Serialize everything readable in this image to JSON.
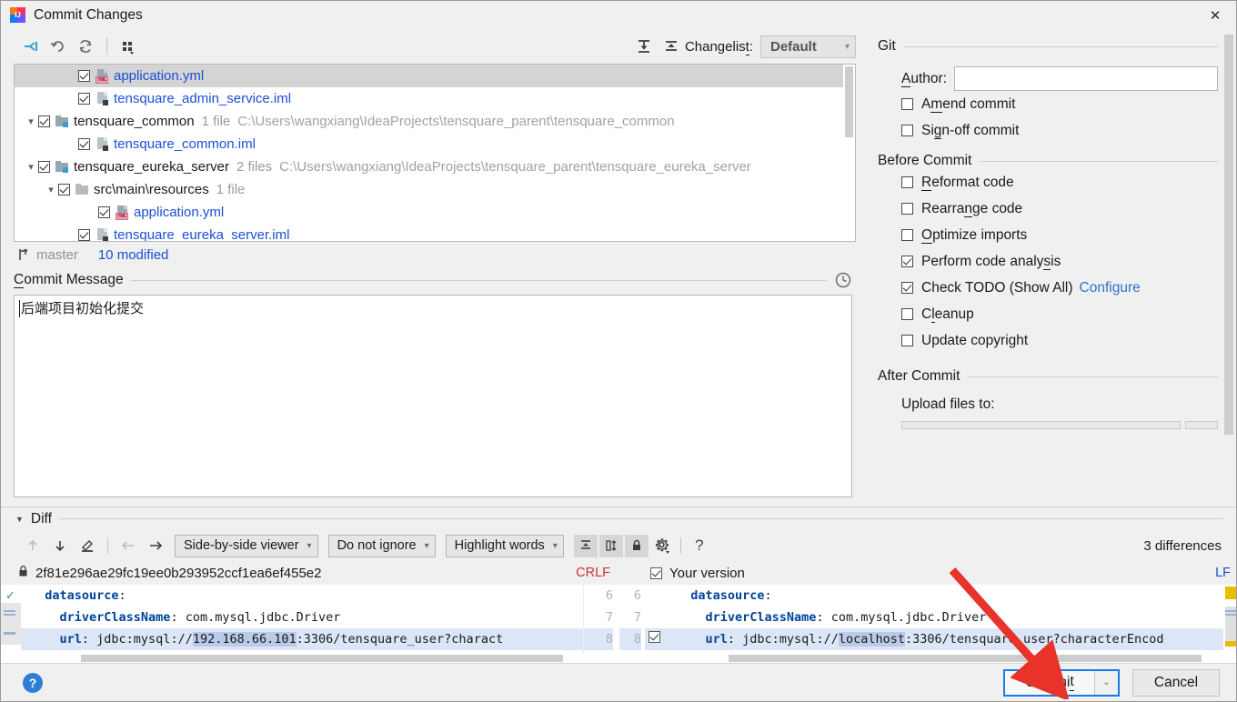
{
  "window": {
    "title": "Commit Changes",
    "app_icon": "intellij-idea-icon",
    "close_label": "✕"
  },
  "changes_toolbar": {
    "buttons": [
      {
        "name": "show-diff-icon",
        "glyph": "→|"
      },
      {
        "name": "revert-icon",
        "glyph": "↶"
      },
      {
        "name": "refresh-icon",
        "glyph": "↻"
      },
      {
        "name": "group-by-icon",
        "glyph": "∷"
      }
    ],
    "expand_all_label": "expand-all-icon",
    "collapse_all_label": "collapse-all-icon",
    "changelist_label": "Changelist:",
    "changelist_value": "Default",
    "changelist_arrow": "⌄"
  },
  "file_tree": {
    "rows": [
      {
        "indent": 2,
        "twisty": "",
        "checked": true,
        "icon": "yml-file-icon",
        "name": "application.yml",
        "link": true,
        "meta": "",
        "path": "",
        "selected": true
      },
      {
        "indent": 2,
        "twisty": "",
        "checked": true,
        "icon": "iml-file-icon",
        "name": "tensquare_admin_service.iml",
        "link": true,
        "meta": "",
        "path": "",
        "selected": false
      },
      {
        "indent": 0,
        "twisty": "⌄",
        "checked": true,
        "icon": "module-folder-icon",
        "name": "tensquare_common",
        "link": false,
        "meta": "1 file",
        "path": "C:\\Users\\wangxiang\\IdeaProjects\\tensquare_parent\\tensquare_common",
        "selected": false
      },
      {
        "indent": 2,
        "twisty": "",
        "checked": true,
        "icon": "iml-file-icon",
        "name": "tensquare_common.iml",
        "link": true,
        "meta": "",
        "path": "",
        "selected": false
      },
      {
        "indent": 0,
        "twisty": "⌄",
        "checked": true,
        "icon": "module-folder-icon",
        "name": "tensquare_eureka_server",
        "link": false,
        "meta": "2 files",
        "path": "C:\\Users\\wangxiang\\IdeaProjects\\tensquare_parent\\tensquare_eureka_server",
        "selected": false
      },
      {
        "indent": 1,
        "twisty": "⌄",
        "checked": true,
        "icon": "folder-icon",
        "name": "src\\main\\resources",
        "link": false,
        "meta": "1 file",
        "path": "",
        "selected": false
      },
      {
        "indent": 3,
        "twisty": "",
        "checked": true,
        "icon": "yml-file-icon",
        "name": "application.yml",
        "link": true,
        "meta": "",
        "path": "",
        "selected": false
      },
      {
        "indent": 2,
        "twisty": "",
        "checked": true,
        "icon": "iml-file-icon",
        "name": "tensquare_eureka_server.iml",
        "link": true,
        "meta": "",
        "path": "",
        "selected": false
      }
    ]
  },
  "branch_bar": {
    "branch_icon": "git-branch-icon",
    "branch": "master",
    "modified": "10 modified"
  },
  "commit_message": {
    "title": "Commit Message",
    "title_mnemonic": "C",
    "history_icon": "clock-history-icon",
    "value": "后端项目初始化提交"
  },
  "git_section": {
    "title": "Git",
    "author_label": "Author:",
    "author_mnemonic": "A",
    "author_value": "",
    "author_placeholder": "",
    "checkboxes": [
      {
        "label": "Amend commit",
        "mnemonic": "m",
        "checked": false
      },
      {
        "label": "Sign-off commit",
        "mnemonic": "g",
        "checked": false
      }
    ]
  },
  "before_commit_section": {
    "title": "Before Commit",
    "checkboxes": [
      {
        "label": "Reformat code",
        "mnemonic": "R",
        "checked": false,
        "link": ""
      },
      {
        "label": "Rearrange code",
        "mnemonic": "n",
        "checked": false,
        "link": ""
      },
      {
        "label": "Optimize imports",
        "mnemonic": "O",
        "checked": false,
        "link": ""
      },
      {
        "label": "Perform code analysis",
        "mnemonic": "s",
        "checked": true,
        "link": ""
      },
      {
        "label": "Check TODO (Show All)",
        "mnemonic": "",
        "checked": true,
        "link": "Configure"
      },
      {
        "label": "Cleanup",
        "mnemonic": "l",
        "checked": false,
        "link": ""
      },
      {
        "label": "Update copyright",
        "mnemonic": "",
        "checked": false,
        "link": ""
      }
    ]
  },
  "after_commit_section": {
    "title": "After Commit",
    "upload_label": "Upload files to:",
    "upload_value": ""
  },
  "diff_section": {
    "title": "Diff",
    "caret": "▼",
    "toolbar": {
      "prev_diff_icon": "arrow-up-icon",
      "next_diff_icon": "arrow-down-icon",
      "edit_icon": "pencil-icon",
      "accept_left_icon": "arrow-left-icon",
      "accept_right_icon": "arrow-right-icon",
      "viewer_mode": "Side-by-side viewer",
      "whitespace_mode": "Do not ignore",
      "highlight_mode": "Highlight words",
      "collapse_unchanged_icon": "collapse-lines-icon",
      "synchronize_icon": "sync-scroll-icon",
      "readonly_icon": "lock-icon",
      "settings_icon": "gear-icon",
      "help_icon": "question-icon",
      "differences_count": "3 differences"
    },
    "left_pane": {
      "lock_icon": "lock-icon",
      "revision": "2f81e296ae29fc19ee0b293952ccf1ea6ef455e2",
      "eol": "CRLF",
      "lines": [
        {
          "num": "6",
          "indent": 2,
          "key": "datasource",
          "sep": ":",
          "value": "",
          "highlight": false
        },
        {
          "num": "7",
          "indent": 4,
          "key": "driverClassName",
          "sep": ":",
          "value": " com.mysql.jdbc.Driver",
          "highlight": false
        },
        {
          "num": "8",
          "indent": 4,
          "key": "url",
          "sep": ":",
          "value": " jdbc:mysql://192.168.66.101:3306/tensquare_user?charact",
          "highlight": true,
          "token": "192.168.66.101"
        }
      ]
    },
    "right_pane": {
      "checkbox_checked": true,
      "title": "Your version",
      "eol": "LF",
      "lines": [
        {
          "num": "6",
          "indent": 2,
          "key": "datasource",
          "sep": ":",
          "value": "",
          "highlight": false
        },
        {
          "num": "7",
          "indent": 4,
          "key": "driverClassName",
          "sep": ":",
          "value": " com.mysql.jdbc.Driver",
          "highlight": false
        },
        {
          "num": "8",
          "indent": 4,
          "key": "url",
          "sep": ":",
          "value": " jdbc:mysql://localhost:3306/tensquare_user?characterEncod",
          "highlight": true,
          "token": "localhost"
        }
      ]
    }
  },
  "footer": {
    "help_icon": "help-icon",
    "help_glyph": "?",
    "commit_label": "Commit",
    "commit_mnemonic": "t",
    "commit_arrow": "⌄",
    "cancel_label": "Cancel"
  }
}
